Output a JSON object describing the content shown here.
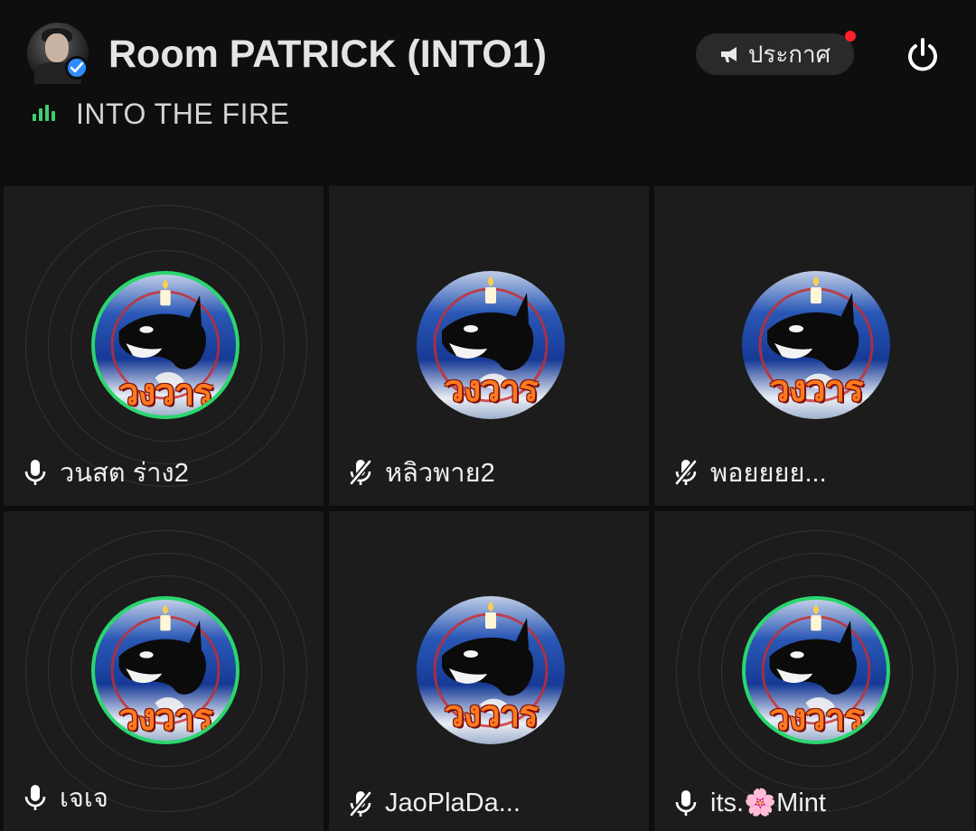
{
  "header": {
    "room_title": "Room PATRICK (INTO1)",
    "room_topic": "INTO THE FIRE",
    "announce_label": "ประกาศ",
    "announce_has_notification": true,
    "colors": {
      "accent_green": "#2bd66e",
      "notification_red": "#ff1f2e",
      "verified_blue": "#2f8cff"
    }
  },
  "participants": [
    {
      "name": "วนสต ร่าง2",
      "mic": "on",
      "speaking": true,
      "avatar_text": "วงวาร",
      "avatar_icon": "orca-candle-avatar"
    },
    {
      "name": "หลิวพาย2",
      "mic": "muted",
      "speaking": false,
      "avatar_text": "วงวาร",
      "avatar_icon": "orca-candle-avatar"
    },
    {
      "name": "พอยยยย...",
      "mic": "muted",
      "speaking": false,
      "avatar_text": "วงวาร",
      "avatar_icon": "orca-candle-avatar"
    },
    {
      "name": "เจเจ",
      "mic": "on",
      "speaking": true,
      "avatar_text": "วงวาร",
      "avatar_icon": "orca-candle-avatar"
    },
    {
      "name": "JaoPlaDa...",
      "mic": "muted",
      "speaking": false,
      "avatar_text": "วงวาร",
      "avatar_icon": "orca-candle-avatar"
    },
    {
      "name": "its.🌸Mint",
      "mic": "on",
      "speaking": true,
      "avatar_text": "วงวาร",
      "avatar_icon": "orca-candle-avatar"
    }
  ]
}
